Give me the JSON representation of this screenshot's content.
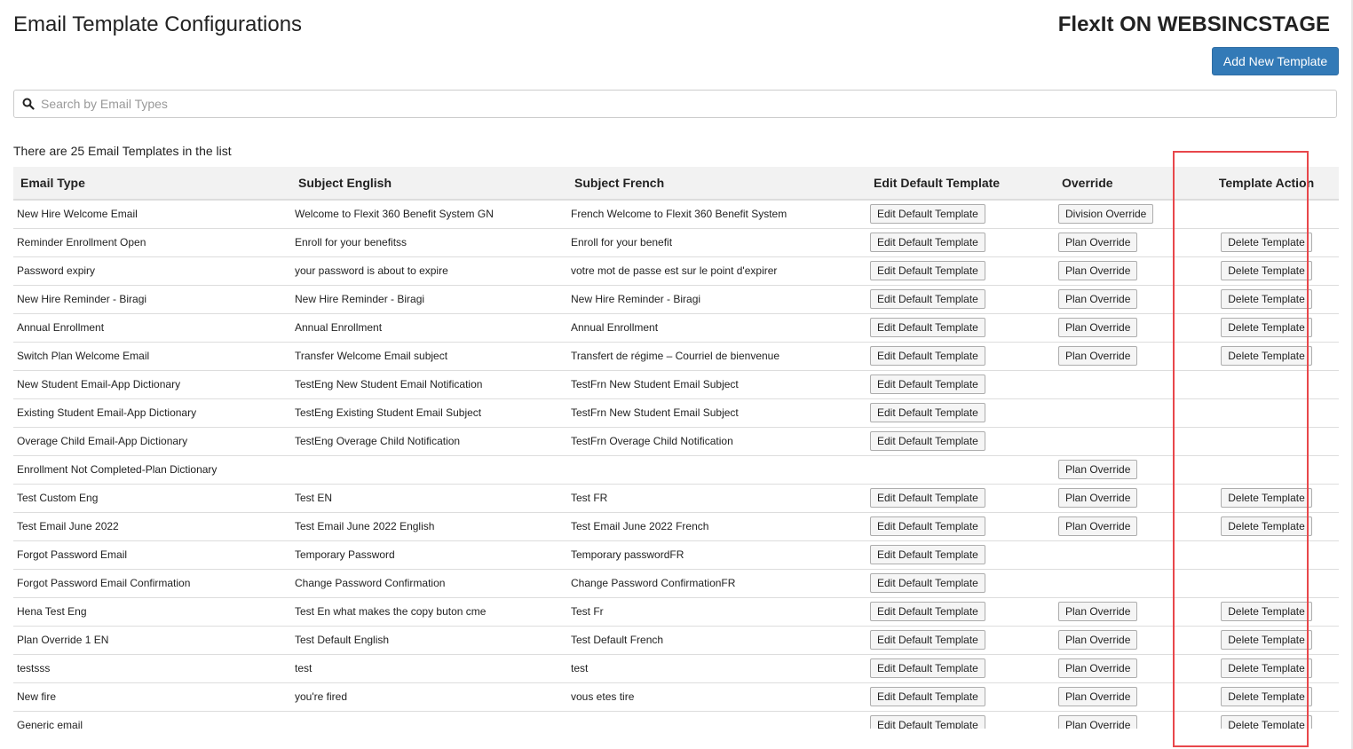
{
  "header": {
    "page_title": "Email Template Configurations",
    "app_title": "FlexIt ON WEBSINCSTAGE",
    "add_button": "Add New Template"
  },
  "search": {
    "placeholder": "Search by Email Types",
    "value": "",
    "icon": "search-icon"
  },
  "count_text": "There are 25 Email Templates in the list",
  "table": {
    "columns": [
      "Email Type",
      "Subject English",
      "Subject French",
      "Edit Default Template",
      "Override",
      "Template Action"
    ],
    "rows": [
      {
        "type": "New Hire Welcome Email",
        "en": "Welcome to Flexit 360 Benefit System GN",
        "fr": "French Welcome to Flexit 360 Benefit System",
        "edit": "Edit Default Template",
        "override": "Division Override",
        "action": ""
      },
      {
        "type": "Reminder Enrollment Open",
        "en": "Enroll for your benefitss",
        "fr": "Enroll for your benefit",
        "edit": "Edit Default Template",
        "override": "Plan Override",
        "action": "Delete Template"
      },
      {
        "type": "Password expiry",
        "en": "your password is about to expire",
        "fr": "votre mot de passe est sur le point d'expirer",
        "edit": "Edit Default Template",
        "override": "Plan Override",
        "action": "Delete Template"
      },
      {
        "type": "New Hire Reminder - Biragi",
        "en": "New Hire Reminder - Biragi",
        "fr": "New Hire Reminder - Biragi",
        "edit": "Edit Default Template",
        "override": "Plan Override",
        "action": "Delete Template"
      },
      {
        "type": "Annual Enrollment",
        "en": "Annual Enrollment",
        "fr": "Annual Enrollment",
        "edit": "Edit Default Template",
        "override": "Plan Override",
        "action": "Delete Template"
      },
      {
        "type": "Switch Plan Welcome Email",
        "en": "Transfer Welcome Email subject",
        "fr": "Transfert de régime – Courriel de bienvenue",
        "edit": "Edit Default Template",
        "override": "Plan Override",
        "action": "Delete Template"
      },
      {
        "type": "New Student Email-App Dictionary",
        "en": "TestEng New Student Email Notification",
        "fr": "TestFrn New Student Email Subject",
        "edit": "Edit Default Template",
        "override": "",
        "action": ""
      },
      {
        "type": "Existing Student Email-App Dictionary",
        "en": "TestEng Existing Student Email Subject",
        "fr": "TestFrn New Student Email Subject",
        "edit": "Edit Default Template",
        "override": "",
        "action": ""
      },
      {
        "type": "Overage Child Email-App Dictionary",
        "en": "TestEng Overage Child Notification",
        "fr": "TestFrn Overage Child Notification",
        "edit": "Edit Default Template",
        "override": "",
        "action": ""
      },
      {
        "type": "Enrollment Not Completed-Plan Dictionary",
        "en": "",
        "fr": "",
        "edit": "",
        "override": "Plan Override",
        "action": ""
      },
      {
        "type": "Test Custom Eng",
        "en": "Test EN",
        "fr": "Test FR",
        "edit": "Edit Default Template",
        "override": "Plan Override",
        "action": "Delete Template"
      },
      {
        "type": "Test Email June 2022",
        "en": "Test Email June 2022 English",
        "fr": "Test Email June 2022 French",
        "edit": "Edit Default Template",
        "override": "Plan Override",
        "action": "Delete Template"
      },
      {
        "type": "Forgot Password Email",
        "en": "Temporary Password",
        "fr": "Temporary passwordFR",
        "edit": "Edit Default Template",
        "override": "",
        "action": ""
      },
      {
        "type": "Forgot Password Email Confirmation",
        "en": "Change Password Confirmation",
        "fr": "Change Password ConfirmationFR",
        "edit": "Edit Default Template",
        "override": "",
        "action": ""
      },
      {
        "type": "Hena Test Eng",
        "en": "Test En what makes the copy buton cme",
        "fr": "Test Fr",
        "edit": "Edit Default Template",
        "override": "Plan Override",
        "action": "Delete Template"
      },
      {
        "type": "Plan Override 1 EN",
        "en": "Test Default English",
        "fr": "Test Default French",
        "edit": "Edit Default Template",
        "override": "Plan Override",
        "action": "Delete Template"
      },
      {
        "type": "testsss",
        "en": "test",
        "fr": "test",
        "edit": "Edit Default Template",
        "override": "Plan Override",
        "action": "Delete Template"
      },
      {
        "type": "New fire",
        "en": "you're fired",
        "fr": "vous etes tire",
        "edit": "Edit Default Template",
        "override": "Plan Override",
        "action": "Delete Template"
      },
      {
        "type": "Generic email",
        "en": "",
        "fr": "",
        "edit": "Edit Default Template",
        "override": "Plan Override",
        "action": "Delete Template"
      }
    ]
  },
  "colors": {
    "primary": "#337ab7",
    "highlight": "#e8474b",
    "header_bg": "#f2f2f2"
  }
}
